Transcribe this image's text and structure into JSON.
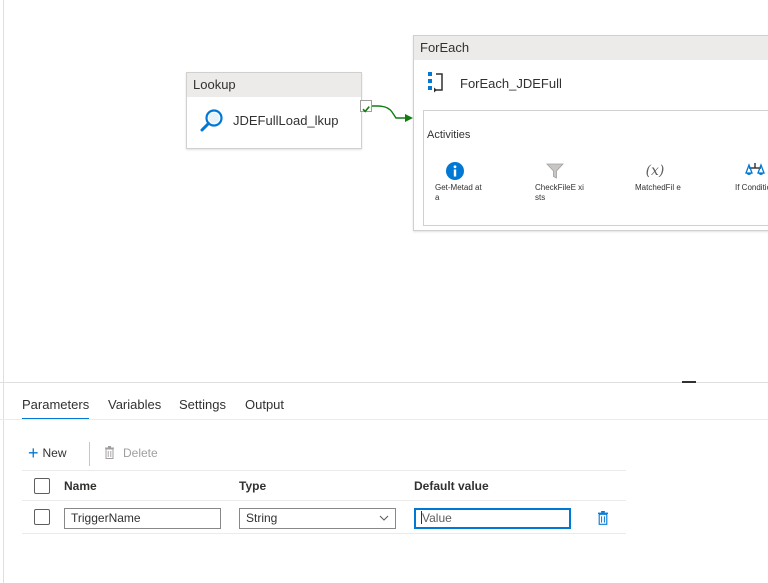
{
  "canvas": {
    "lookup": {
      "header": "Lookup",
      "name": "JDEFullLoad_lkup",
      "icon": "magnifier-icon"
    },
    "foreach": {
      "header": "ForEach",
      "name": "ForEach_JDEFull",
      "icon": "foreach-icon",
      "activities_title": "Activities",
      "activities": [
        {
          "label": "Get-Metad ata",
          "icon": "info-icon"
        },
        {
          "label": "CheckFileE xists",
          "icon": "filter-icon"
        },
        {
          "label": "MatchedFil e",
          "icon": "variable-icon",
          "glyph": "(x)"
        },
        {
          "label": "If Conditio",
          "icon": "if-condition-icon"
        }
      ]
    },
    "colors": {
      "accent": "#0078d4",
      "success": "#107c10",
      "header_bg": "#edebe9"
    }
  },
  "panel": {
    "tabs": [
      {
        "label": "Parameters",
        "active": true
      },
      {
        "label": "Variables",
        "active": false
      },
      {
        "label": "Settings",
        "active": false
      },
      {
        "label": "Output",
        "active": false
      }
    ],
    "toolbar": {
      "new_label": "New",
      "delete_label": "Delete"
    },
    "grid": {
      "columns": [
        "Name",
        "Type",
        "Default value"
      ],
      "rows": [
        {
          "name": "TriggerName",
          "type": "String",
          "default_placeholder": "Value"
        }
      ]
    }
  }
}
